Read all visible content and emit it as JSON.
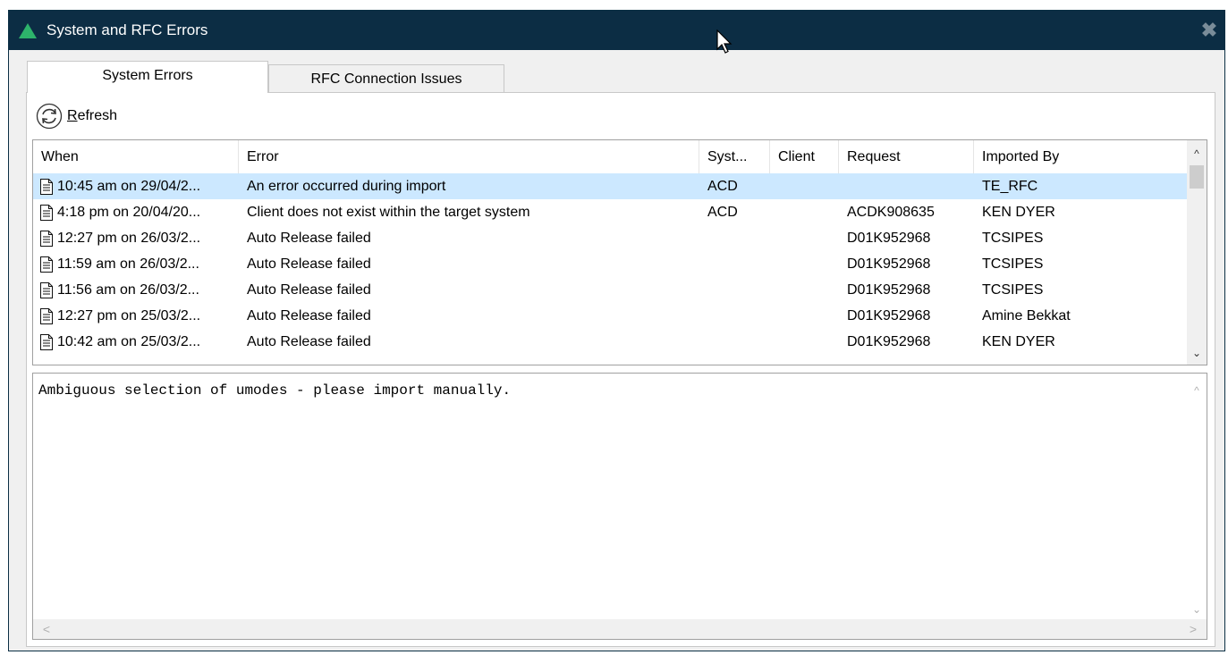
{
  "window": {
    "title": "System and RFC Errors",
    "close_glyph": "✖",
    "title_bar_color": "#0c2d44",
    "logo_color": "#2db36b"
  },
  "tabs": [
    {
      "label": "System Errors",
      "active": true
    },
    {
      "label": "RFC Connection Issues",
      "active": false
    }
  ],
  "toolbar": {
    "refresh_mnemonic": "R",
    "refresh_rest": "efresh",
    "refresh_icon": "refresh-icon"
  },
  "grid": {
    "columns": [
      "When",
      "Error",
      "Syst...",
      "Client",
      "Request",
      "Imported By"
    ],
    "rows": [
      {
        "when": "10:45 am on 29/04/2...",
        "error": "An error occurred during import",
        "syst": "ACD",
        "client": "",
        "request": "",
        "imported_by": "TE_RFC",
        "selected": true
      },
      {
        "when": "4:18 pm on 20/04/20...",
        "error": "Client does not exist within the target system",
        "syst": "ACD",
        "client": "",
        "request": "ACDK908635",
        "imported_by": "KEN DYER",
        "selected": false
      },
      {
        "when": "12:27 pm on 26/03/2...",
        "error": "Auto Release failed",
        "syst": "",
        "client": "",
        "request": "D01K952968",
        "imported_by": "TCSIPES",
        "selected": false
      },
      {
        "when": "11:59 am on 26/03/2...",
        "error": "Auto Release failed",
        "syst": "",
        "client": "",
        "request": "D01K952968",
        "imported_by": "TCSIPES",
        "selected": false
      },
      {
        "when": "11:56 am on 26/03/2...",
        "error": "Auto Release failed",
        "syst": "",
        "client": "",
        "request": "D01K952968",
        "imported_by": "TCSIPES",
        "selected": false
      },
      {
        "when": "12:27 pm on 25/03/2...",
        "error": "Auto Release failed",
        "syst": "",
        "client": "",
        "request": "D01K952968",
        "imported_by": "Amine Bekkat",
        "selected": false
      },
      {
        "when": "10:42 am on 25/03/2...",
        "error": "Auto Release failed",
        "syst": "",
        "client": "",
        "request": "D01K952968",
        "imported_by": "KEN DYER",
        "selected": false
      }
    ],
    "selected_color": "#cce8ff",
    "row_icon": "document-icon"
  },
  "detail": {
    "text": "Ambiguous selection of umodes - please import manually."
  },
  "scroll": {
    "up": "^",
    "down": "⌄",
    "left": "<",
    "right": ">"
  }
}
